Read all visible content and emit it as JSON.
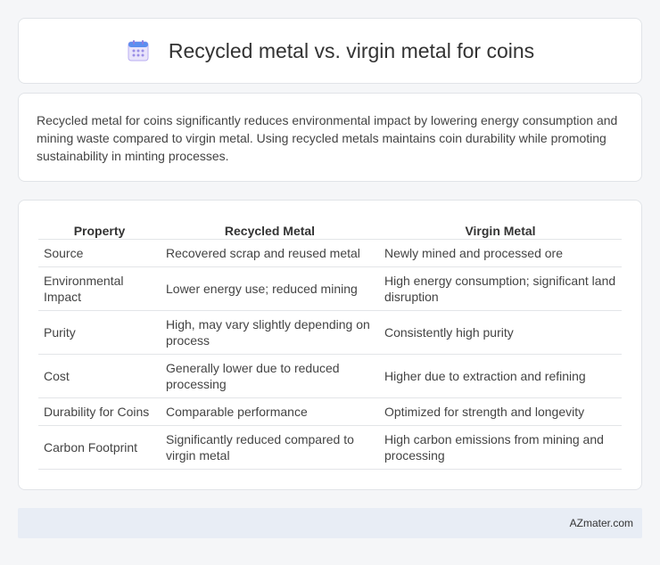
{
  "header": {
    "title": "Recycled metal vs. virgin metal for coins",
    "icon": "calendar-icon"
  },
  "intro": {
    "text": "Recycled metal for coins significantly reduces environmental impact by lowering energy consumption and mining waste compared to virgin metal. Using recycled metals maintains coin durability while promoting sustainability in minting processes."
  },
  "table": {
    "headers": [
      "Property",
      "Recycled Metal",
      "Virgin Metal"
    ],
    "rows": [
      [
        "Source",
        "Recovered scrap and reused metal",
        "Newly mined and processed ore"
      ],
      [
        "Environmental Impact",
        "Lower energy use; reduced mining",
        "High energy consumption; significant land disruption"
      ],
      [
        "Purity",
        "High, may vary slightly depending on process",
        "Consistently high purity"
      ],
      [
        "Cost",
        "Generally lower due to reduced processing",
        "Higher due to extraction and refining"
      ],
      [
        "Durability for Coins",
        "Comparable performance",
        "Optimized for strength and longevity"
      ],
      [
        "Carbon Footprint",
        "Significantly reduced compared to virgin metal",
        "High carbon emissions from mining and processing"
      ]
    ]
  },
  "footer": {
    "text": "AZmater.com"
  }
}
